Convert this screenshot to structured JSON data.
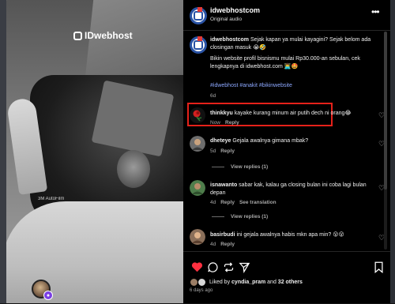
{
  "video": {
    "brand": "IDwebhost",
    "watermark": "3M AutoFilm"
  },
  "header": {
    "username": "idwebhostcom",
    "audio": "Original audio"
  },
  "caption": {
    "username": "idwebhostcom",
    "line1": " Sejak kapan ya mulai kayagini? Sejak belom ada closingan masuk 😭🤣",
    "line2": "Bikin website profil bisnismu mulai Rp30.000-an sebulan, cek lengkapnya di idwebhost.com 👨‍💻🤩",
    "hashtags": "#idwebhost #anakit #bikinwebsite",
    "time": "6d"
  },
  "comments": [
    {
      "username": "thinkkyu",
      "text": " kayake kurang minum air putih dech ni orang😂",
      "time": "Now",
      "reply": "Reply"
    },
    {
      "username": "dheteye",
      "text": " Gejala awalnya gimana mbak?",
      "time": "5d",
      "reply": "Reply",
      "view_replies": "View replies (1)"
    },
    {
      "username": "isnawanto",
      "text": " sabar kak, kalau ga closing bulan ini coba lagi bulan depan",
      "time": "4d",
      "reply": "Reply",
      "see_translation": "See translation",
      "view_replies": "View replies (1)"
    },
    {
      "username": "basirbudi",
      "text": " ini gejala awalnya habis mkn apa min? 😮😮",
      "time": "4d",
      "reply": "Reply"
    }
  ],
  "likes": {
    "prefix": "Liked by ",
    "user": "cyndia_pram",
    "and": " and ",
    "others": "32 others"
  },
  "posted": "6 days ago",
  "colors": {
    "highlight": "#e5211a",
    "liked_heart": "#ff3040",
    "hashtag": "#8da8ff",
    "badge": "#7b3fe4"
  },
  "icons": [
    "more-icon",
    "heart-icon",
    "comment-icon",
    "repost-icon",
    "share-icon",
    "bookmark-icon",
    "heart-outline-icon"
  ]
}
